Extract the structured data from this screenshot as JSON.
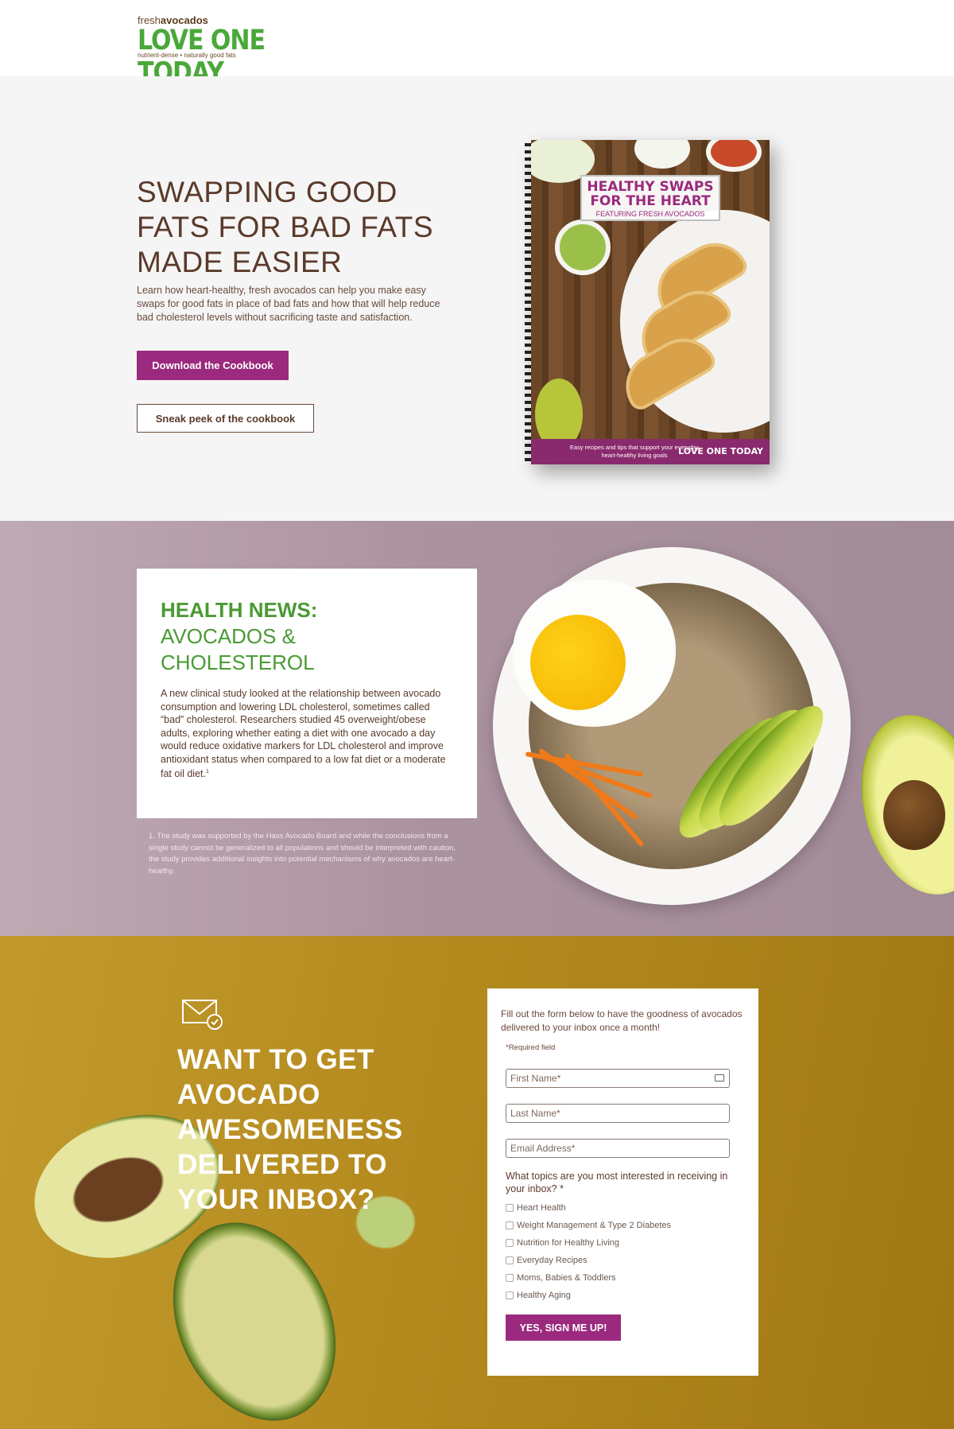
{
  "brand": {
    "top_text": "fresh",
    "top_text_bold": "avocados",
    "name": "LOVE ONE TODAY",
    "tagline": "nutrient-dense • naturally good fats"
  },
  "hero": {
    "title": "SWAPPING GOOD FATS FOR BAD FATS MADE EASIER",
    "description": "Learn how heart-healthy, fresh avocados can help you make easy swaps for good fats in place of bad fats and how that will help reduce bad cholesterol levels without sacrificing taste and satisfaction.",
    "primary_button": "Download the Cookbook",
    "secondary_button": "Sneak peek of the cookbook"
  },
  "cookbook": {
    "title": "HEALTHY SWAPS FOR THE HEART",
    "subtitle": "FEATURING FRESH AVOCADOS",
    "band_text": "Easy recipes and tips that support your everyday heart-healthy living goals",
    "band_logo": "LOVE ONE TODAY"
  },
  "news": {
    "title_bold": "HEALTH NEWS:",
    "title_rest": "AVOCADOS & CHOLESTEROL",
    "body": "A new clinical study looked at the relationship between avocado consumption and lowering LDL cholesterol, sometimes called “bad” cholesterol. Researchers studied 45 overweight/obese adults, exploring whether eating a diet with one avocado a day would reduce oxidative markers for LDL cholesterol and improve antioxidant status when compared to a low fat diet or a moderate fat oil diet.",
    "footnote_mark": "1",
    "footnote": "1. The study was supported by the Hass Avocado Board and while the conclusions from a single study cannot be generalized to all populations and should be interpreted with caution, the study provides additional insights into potential mechanisms of why avocados are heart-healthy."
  },
  "signup": {
    "title": "WANT TO GET AVOCADO AWESOMENESS DELIVERED TO YOUR INBOX?",
    "form": {
      "intro": "Fill out the form below to have the goodness of avocados delivered to your inbox once a month!",
      "required_note": "*Required field",
      "first_name_placeholder": "First Name*",
      "last_name_placeholder": "Last Name*",
      "email_placeholder": "Email Address*",
      "topics_question": "What topics are you most interested in receiving in your inbox? *",
      "topics": [
        "Heart Health",
        "Weight Management & Type 2 Diabetes",
        "Nutrition for Healthy Living",
        "Everyday Recipes",
        "Moms, Babies & Toddlers",
        "Healthy Aging"
      ],
      "submit": "YES, SIGN ME UP!"
    }
  },
  "colors": {
    "brand_green": "#4aa83a",
    "brand_purple": "#9b2a7e",
    "text_brown": "#5a3a2a",
    "signup_gold": "#b48a1e"
  }
}
